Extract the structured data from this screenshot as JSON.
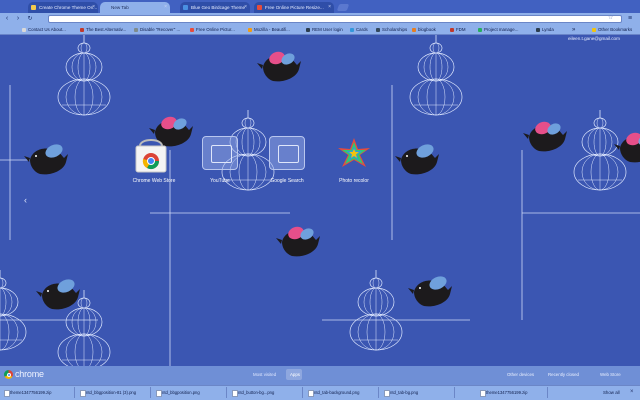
{
  "tabs": [
    {
      "label": "Create Chrome Theme On...",
      "active": false
    },
    {
      "label": "New Tab",
      "active": true
    },
    {
      "label": "Blue Geo Birdcage Theme",
      "active": false
    },
    {
      "label": "Free Online Picture Resize...",
      "active": false
    }
  ],
  "toolbar": {
    "back": "‹",
    "forward": "›",
    "reload": "↻",
    "omnibox_value": "",
    "star": "☆",
    "menu": "≡"
  },
  "bookmarks": [
    {
      "label": "Contact Us About...",
      "color": "#d9d9d9"
    },
    {
      "label": "The Best Alternativ...",
      "color": "#c0392b"
    },
    {
      "label": "Disable \"Recover\" ...",
      "color": "#7f8c8d"
    },
    {
      "label": "Free Online Pictur...",
      "color": "#e74c3c"
    },
    {
      "label": "Mozilla - Beautifi...",
      "color": "#f39c12"
    },
    {
      "label": "REM User login",
      "color": "#2c3e50"
    },
    {
      "label": "Cards",
      "color": "#3498db"
    },
    {
      "label": "Scholarships",
      "color": "#34495e"
    },
    {
      "label": "blogbook",
      "color": "#e67e22"
    },
    {
      "label": "FDM",
      "color": "#c0392b"
    },
    {
      "label": "Project manage...",
      "color": "#27ae60"
    },
    {
      "label": "Lynda",
      "color": "#2c3e50"
    },
    {
      "label": "»",
      "color": ""
    },
    {
      "label": "Other Bookmarks",
      "color": "#f1c40f"
    }
  ],
  "ntp": {
    "signin_email": "eileen.t.gane@gmail.com",
    "apps": [
      {
        "label": "Chrome Web Store",
        "icon": "webstore-icon"
      },
      {
        "label": "YouTube",
        "icon": "placeholder-app-icon"
      },
      {
        "label": "Google Search",
        "icon": "placeholder-app-icon"
      },
      {
        "label": "Photo recolor",
        "icon": "star-burst-icon"
      }
    ],
    "pager_left": "‹"
  },
  "footer": {
    "brand": "chrome",
    "most_visited": "Most visited",
    "apps": "Apps",
    "other_devices": "Other devices",
    "recently_closed": "Recently closed",
    "web_store": "Web Store"
  },
  "downloads": {
    "items": [
      "theme1347756199.zip",
      "ntd_bbgposition-81 (3).png",
      "ntd_bbgposition.png",
      "ntd_button-bg...png",
      "ntd_tab-background.png",
      "ntd_tab-bg.png",
      "theme1347756199.zip"
    ],
    "show_all": "Show all",
    "close": "×"
  },
  "colors": {
    "background": "#3b56b2",
    "frame": "#8fb0ea",
    "accent_pink": "#e64f8a",
    "accent_blue": "#6fa0dc"
  }
}
